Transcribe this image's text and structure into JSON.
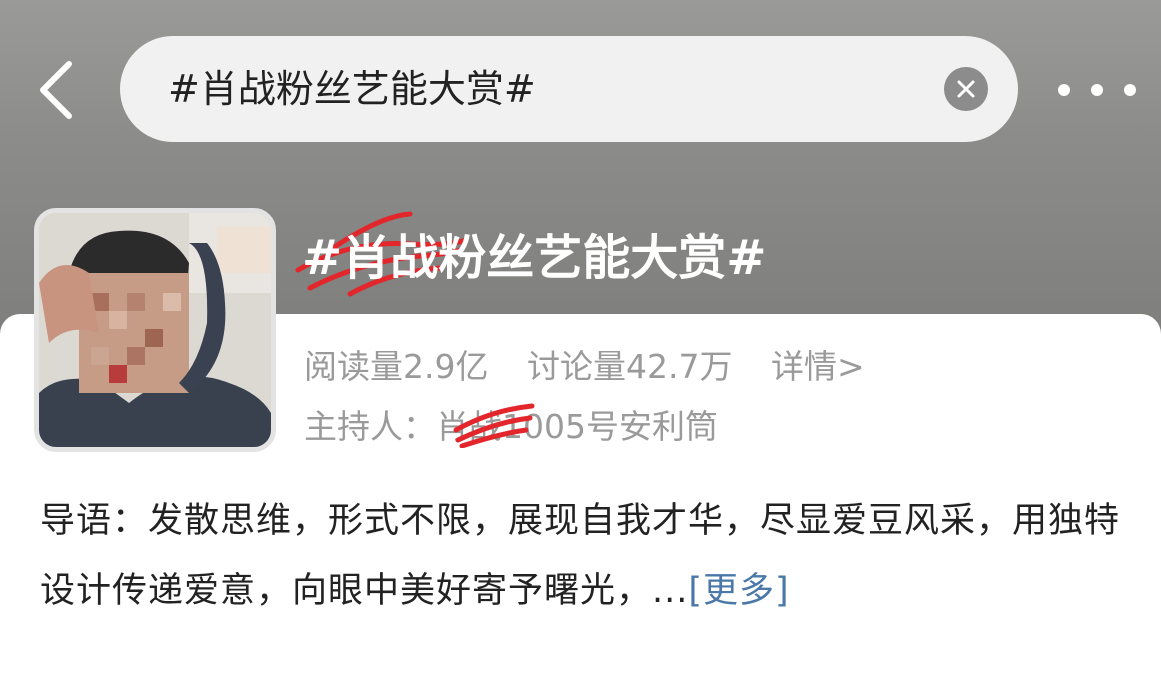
{
  "nav": {
    "back_icon": "chevron-left-icon",
    "more_icon": "more-horizontal-icon"
  },
  "search": {
    "query": "#肖战粉丝艺能大赏#",
    "clear_icon": "close-icon"
  },
  "topic": {
    "title": "#肖战粉丝艺能大赏#",
    "reads": "阅读量2.9亿",
    "discussions": "讨论量42.7万",
    "details": "详情>",
    "host_label": "主持人：",
    "host_name": "肖战1005号安利筒"
  },
  "intro": {
    "text": "导语：发散思维，形式不限，展现自我才华，尽显爱豆风采，用独特设计传递爱意，向眼中美好寄予曙光，...",
    "more": "[更多]"
  },
  "colors": {
    "header_gray": "#8c8c8a",
    "link_blue": "#4a78a8",
    "scribble_red": "#e2262c",
    "meta_gray": "#9a9a9a"
  }
}
